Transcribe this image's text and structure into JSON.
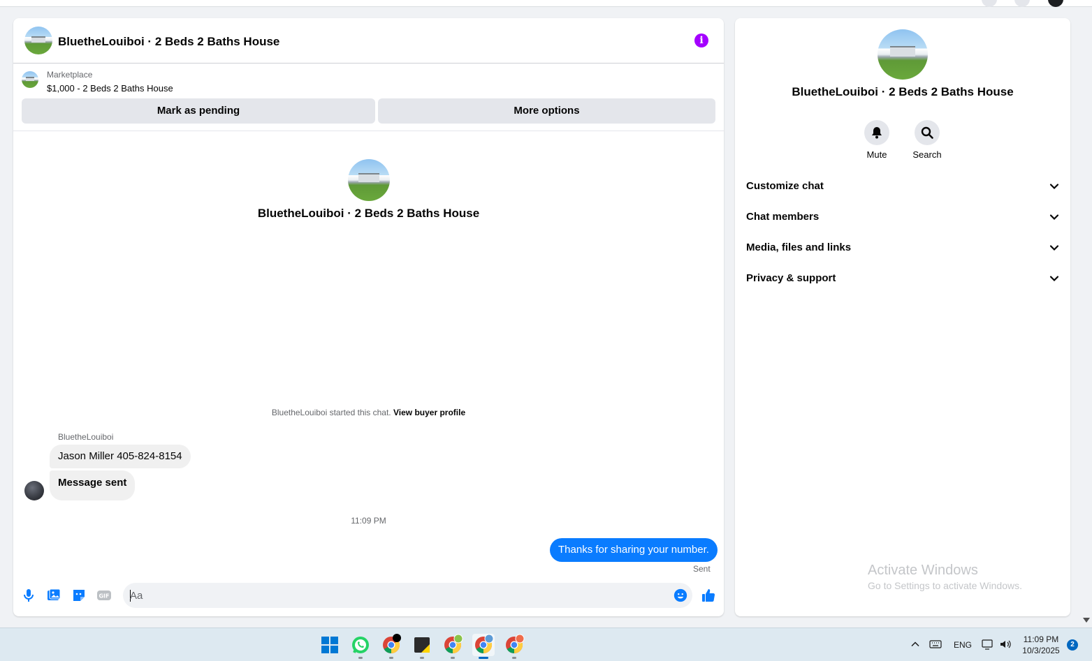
{
  "chat": {
    "title": "BluetheLouiboi · 2 Beds 2 Baths House",
    "marketplace_label": "Marketplace",
    "listing": "$1,000 - 2 Beds 2 Baths House",
    "mark_pending_label": "Mark as pending",
    "more_options_label": "More options",
    "intro_name": "BluetheLouiboi · 2 Beds 2 Baths House",
    "started_text": "BluetheLouiboi started this chat.",
    "view_profile_label": "View buyer profile",
    "sender_name": "BluetheLouiboi",
    "messages_in": [
      "Jason Miller 405-824-8154",
      "Message sent"
    ],
    "timestamp": "11:09 PM",
    "message_out": "Thanks for sharing your number.",
    "sent_status": "Sent",
    "input_placeholder": "Aa",
    "accent_color": "#0a7cff",
    "info_color": "#a400ff"
  },
  "details": {
    "name": "BluetheLouiboi · 2 Beds 2 Baths House",
    "mute_label": "Mute",
    "search_label": "Search",
    "sections": [
      "Customize chat",
      "Chat members",
      "Media, files and links",
      "Privacy & support"
    ]
  },
  "watermark": {
    "title": "Activate Windows",
    "subtitle": "Go to Settings to activate Windows."
  },
  "taskbar": {
    "apps": [
      "windows-start",
      "whatsapp",
      "chrome",
      "sticky-notes",
      "chrome-profile-1",
      "chrome-profile-2",
      "chrome-profile-3"
    ],
    "language": "ENG",
    "time": "11:09 PM",
    "date": "10/3/2025",
    "notification_count": "2"
  }
}
